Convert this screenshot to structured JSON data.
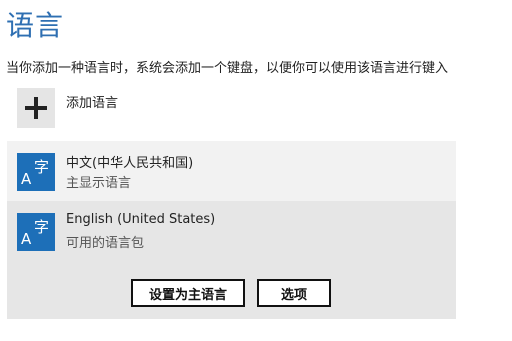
{
  "page": {
    "title": "语言",
    "description": "当你添加一种语言时，系统会添加一个键盘，以便你可以使用该语言进行键入"
  },
  "add_language": {
    "label": "添加语言",
    "icon": "plus-icon"
  },
  "languages": [
    {
      "name": "中文(中华人民共和国)",
      "status": "主显示语言",
      "icon_text_a": "A",
      "icon_text_z": "字"
    },
    {
      "name": "English (United States)",
      "status": "可用的语言包",
      "icon_text_a": "A",
      "icon_text_z": "字"
    }
  ],
  "actions": {
    "set_primary": "设置为主语言",
    "options": "选项"
  },
  "colors": {
    "accent": "#2e6fb2",
    "tile": "#1d6fb8"
  }
}
